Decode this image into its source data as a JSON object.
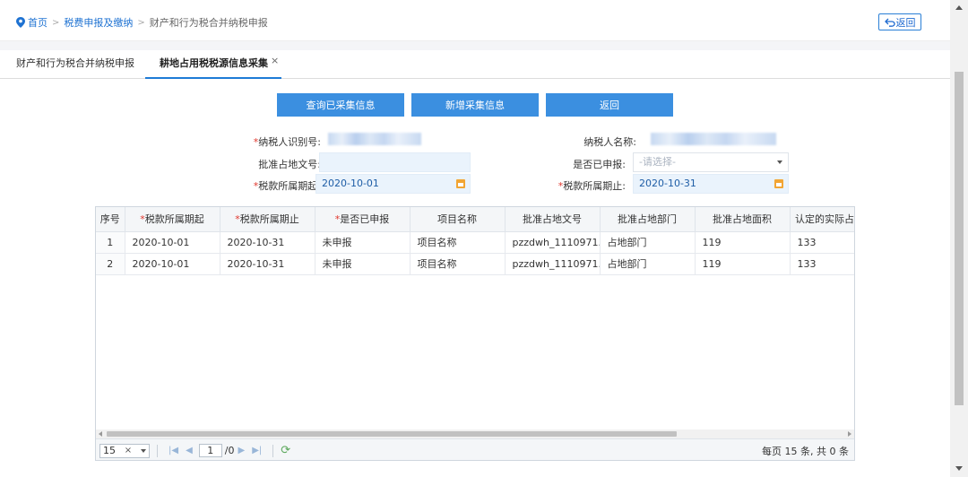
{
  "breadcrumb": {
    "home": "首页",
    "level1": "税费申报及缴纳",
    "level2": "财产和行为税合并纳税申报",
    "separator": ">"
  },
  "header": {
    "back_label": "返回"
  },
  "tabs": [
    {
      "label": "财产和行为税合并纳税申报"
    },
    {
      "label": "耕地占用税税源信息采集",
      "close": "×"
    }
  ],
  "actions": {
    "query_label": "查询已采集信息",
    "add_label": "新增采集信息",
    "back_label": "返回"
  },
  "form": {
    "required_mark": "*",
    "taxpayer_id_label": "纳税人识别号:",
    "taxpayer_name_label": "纳税人名称:",
    "approval_doc_label": "批准占地文号:",
    "approval_doc_value": "",
    "declared_label": "是否已申报:",
    "declared_placeholder": "-请选择-",
    "period_start_label": "税款所属期起:",
    "period_start_value": "2020-10-01",
    "period_end_label": "税款所属期止:",
    "period_end_value": "2020-10-31"
  },
  "table": {
    "columns": [
      "序号",
      "税款所属期起",
      "税款所属期止",
      "是否已申报",
      "项目名称",
      "批准占地文号",
      "批准占地部门",
      "批准占地面积",
      "认定的实际占"
    ],
    "required_columns": [
      1,
      2,
      3
    ],
    "rows": [
      [
        "1",
        "2020-10-01",
        "2020-10-31",
        "未申报",
        "项目名称",
        "pzzdwh_1110971...",
        "占地部门",
        "119",
        "133"
      ],
      [
        "2",
        "2020-10-01",
        "2020-10-31",
        "未申报",
        "项目名称",
        "pzzdwh_1110971...",
        "占地部门",
        "119",
        "133"
      ]
    ]
  },
  "pager": {
    "page_size": "15",
    "clear": "×",
    "first": "|◀",
    "prev": "◀",
    "current_page": "1",
    "total_pages": "/0",
    "next": "▶",
    "last": "▶|",
    "refresh": "⟳",
    "info": "每页 15 条, 共 0 条"
  },
  "colors": {
    "accent": "#3b8fe0",
    "link": "#1e72d2",
    "required": "#e0362c"
  }
}
